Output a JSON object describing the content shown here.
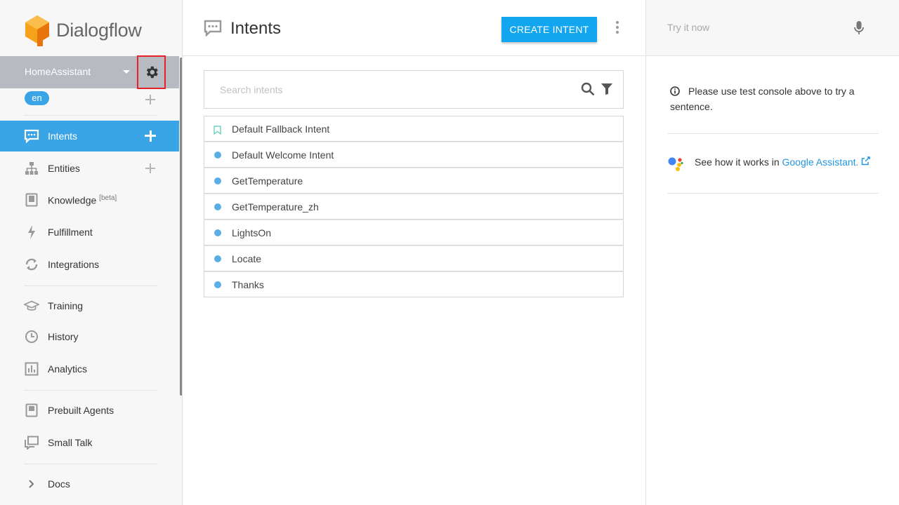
{
  "app": {
    "name": "Dialogflow"
  },
  "agent": {
    "name": "HomeAssistant",
    "language": "en"
  },
  "sidebar": {
    "items": [
      {
        "label": "Intents",
        "icon": "speech-bubble-icon",
        "active": true
      },
      {
        "label": "Entities",
        "icon": "hierarchy-icon"
      },
      {
        "label": "Knowledge",
        "badge": "[beta]",
        "icon": "book-icon"
      },
      {
        "label": "Fulfillment",
        "icon": "lightning-icon"
      },
      {
        "label": "Integrations",
        "icon": "sync-icon"
      },
      {
        "label": "Training",
        "icon": "graduation-cap-icon"
      },
      {
        "label": "History",
        "icon": "clock-icon"
      },
      {
        "label": "Analytics",
        "icon": "bar-chart-icon"
      },
      {
        "label": "Prebuilt Agents",
        "icon": "agent-book-icon"
      },
      {
        "label": "Small Talk",
        "icon": "chat-bubbles-icon"
      },
      {
        "label": "Docs",
        "icon": "chevron-right-icon"
      }
    ]
  },
  "main": {
    "title": "Intents",
    "create_button": "CREATE INTENT",
    "search_placeholder": "Search intents",
    "intents": [
      {
        "name": "Default Fallback Intent",
        "marker": "bookmark"
      },
      {
        "name": "Default Welcome Intent",
        "marker": "dot"
      },
      {
        "name": "GetTemperature",
        "marker": "dot"
      },
      {
        "name": "GetTemperature_zh",
        "marker": "dot"
      },
      {
        "name": "LightsOn",
        "marker": "dot"
      },
      {
        "name": "Locate",
        "marker": "dot"
      },
      {
        "name": "Thanks",
        "marker": "dot"
      }
    ]
  },
  "right_panel": {
    "try_placeholder": "Try it now",
    "info_text": "Please use test console above to try a sentence.",
    "assistant_text": "See how it works in ",
    "assistant_link": "Google Assistant."
  },
  "colors": {
    "accent": "#3aa5e6",
    "button": "#12a6f0",
    "highlight_box": "#e8202a",
    "logo": "#f39c12"
  }
}
